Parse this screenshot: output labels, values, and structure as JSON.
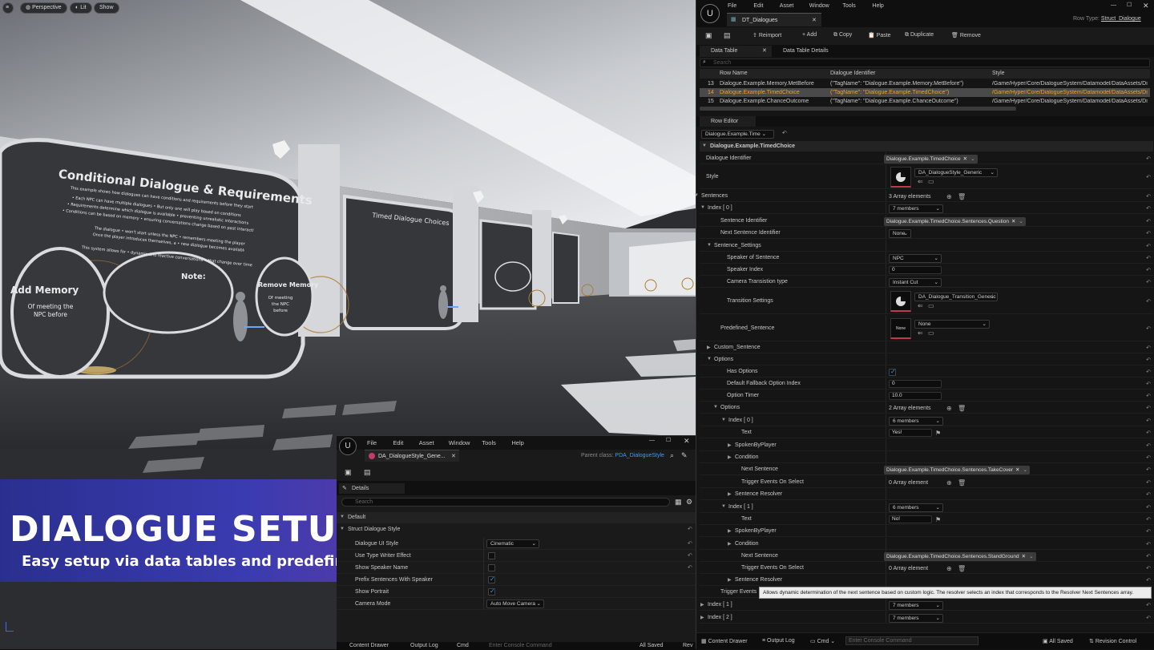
{
  "viewport": {
    "mode": "Perspective",
    "lit": "Lit",
    "show": "Show",
    "wall1": {
      "title": "Conditional Dialogue & Requirements",
      "intro": "This example shows how dialogues can have conditions and requirements before they start",
      "b1": "• Each NPC can have multiple dialogues • But only one will play based on conditions",
      "b2": "• Requirements determine which dialogue is available • preventing unrealistic interactions",
      "b3": "• Conditions can be based on memory • ensuring conversations change based on past interactions",
      "p2a": "The dialogue • won't start unless the NPC • remembers meeting the player •",
      "p2b": "Once the player introduces themselves, a • new dialogue becomes available•",
      "p3": "This system allows for • dynamic and reactive conversations • that change over time",
      "add": "Add Memory",
      "addsub": "Of meeting the NPC before",
      "note": "Note:",
      "remove": "Remove Memory",
      "removesub": "Of meeting the NPC before"
    },
    "wall2": {
      "title": "Timed Dialogue Choices"
    }
  },
  "banner": {
    "title": "DIALOGUE SETUP",
    "subtitle": "Easy setup via data tables and predefined dialog data assets"
  },
  "small_editor": {
    "menu": [
      "File",
      "Edit",
      "Asset",
      "Window",
      "Tools",
      "Help"
    ],
    "tab": "DA_DialogueStyle_Gene...",
    "parent_label": "Parent class:",
    "parent_value": "PDA_DialogueStyle",
    "details_tab": "Details",
    "search_placeholder": "Search",
    "default_section": "Default",
    "struct_section": "Struct Dialogue Style",
    "rows": [
      {
        "label": "Dialogue UI Style",
        "value": "Cinematic"
      },
      {
        "label": "Use Type Writer Effect",
        "value": ""
      },
      {
        "label": "Show Speaker Name",
        "value": ""
      },
      {
        "label": "Prefix Sentences With Speaker",
        "value": ""
      },
      {
        "label": "Show Portrait",
        "value": ""
      },
      {
        "label": "Camera Mode",
        "value": "Auto Move Camera"
      }
    ],
    "bottom": {
      "content_drawer": "Content Drawer",
      "output_log": "Output Log",
      "cmd": "Cmd",
      "console_placeholder": "Enter Console Command",
      "all_saved": "All Saved",
      "rev": "Rev"
    }
  },
  "editor": {
    "menu": [
      "File",
      "Edit",
      "Asset",
      "Window",
      "Tools",
      "Help"
    ],
    "tab": "DT_Dialogues",
    "row_type_label": "Row Type:",
    "row_type_value": "Struct_Dialogue",
    "toolbar": {
      "reimport": "Reimport",
      "add": "Add",
      "copy": "Copy",
      "paste": "Paste",
      "duplicate": "Duplicate",
      "remove": "Remove"
    },
    "tabs": {
      "data_table": "Data Table",
      "details": "Data Table Details"
    },
    "search_placeholder": "Search",
    "columns": [
      "Row Name",
      "Dialogue Identifier",
      "Style"
    ],
    "rows": [
      {
        "num": "13",
        "name": "Dialogue.Example.Memory.MetBefore",
        "id": "(\"TagName\": \"Dialogue.Example.Memory.MetBefore\")",
        "style": "/Game/Hyper/Core/DialogueSystem/Datamodel/DataAssets/Di"
      },
      {
        "num": "14",
        "name": "Dialogue.Example.TimedChoice",
        "id": "(\"TagName\": \"Dialogue.Example.TimedChoice\")",
        "style": "/Game/Hyper/Core/DialogueSystem/Datamodel/DataAssets/Di"
      },
      {
        "num": "15",
        "name": "Dialogue.Example.ChanceOutcome",
        "id": "(\"TagName\": \"Dialogue.Example.ChanceOutcome\")",
        "style": "/Game/Hyper/Core/DialogueSystem/Datamodel/DataAssets/Di"
      }
    ],
    "row_editor_tab": "Row Editor",
    "row_selector": "Dialogue.Example.Time",
    "section": "Dialogue.Example.TimedChoice",
    "props": {
      "dialogue_identifier": "Dialogue Identifier",
      "dialogue_identifier_val": "Dialogue.Example.TimedChoice",
      "style": "Style",
      "style_val": "DA_DialogueStyle_Generic",
      "sentences": "Sentences",
      "sentences_val": "3 Array elements",
      "index0": "Index [ 0 ]",
      "index0_val": "7 members",
      "sent_id": "Sentence Identifier",
      "sent_id_val": "Dialogue.Example.TimedChoice.Sentences.Question",
      "next_id": "Next Sentence Identifier",
      "next_id_val": "None",
      "settings": "Sentence_Settings",
      "speaker": "Speaker of Sentence",
      "speaker_val": "NPC",
      "speaker_index": "Speaker Index",
      "speaker_index_val": "0",
      "cam": "Camera Transistion type",
      "cam_val": "Instant Cut",
      "trans": "Transition Settings",
      "trans_val": "DA_Dialogue_Transition_Generic",
      "predef": "Predefined_Sentence",
      "predef_thumb": "None",
      "predef_val": "None",
      "custom": "Custom_Sentence",
      "options": "Options",
      "has_options": "Has Options",
      "fallback": "Default Fallback Option Index",
      "fallback_val": "0",
      "timer": "Option Timer",
      "timer_val": "10.0",
      "options_arr": "Options",
      "options_arr_val": "2 Array elements",
      "oi0": "Index [ 0 ]",
      "oi0_val": "6 members",
      "text": "Text",
      "text0_val": "Yes!",
      "spoken": "SpokenByPlayer",
      "condition": "Condition",
      "next_sentence": "Next Sentence",
      "next0_val": "Dialogue.Example.TimedChoice.Sentences.TakeCover",
      "trigger": "Trigger Events On Select",
      "trigger_val": "0 Array element",
      "resolver": "Sentence Resolver",
      "oi1": "Index [ 1 ]",
      "oi1_val": "6 members",
      "text1_val": "No!",
      "next1_val": "Dialogue.Example.TimedChoice.Sentences.StandGround",
      "trigger_events": "Trigger Events",
      "tooltip": "Allows dynamic determination of the next sentence based on custom logic. The resolver selects an index that corresponds to the Resolver Next Sentences array.",
      "s_index1": "Index [ 1 ]",
      "s_index1_val": "7 members",
      "s_index2": "Index [ 2 ]",
      "s_index2_val": "7 members"
    },
    "bottom": {
      "content_drawer": "Content Drawer",
      "output_log": "Output Log",
      "cmd": "Cmd",
      "console_placeholder": "Enter Console Command",
      "all_saved": "All Saved",
      "revision": "Revision Control"
    }
  }
}
